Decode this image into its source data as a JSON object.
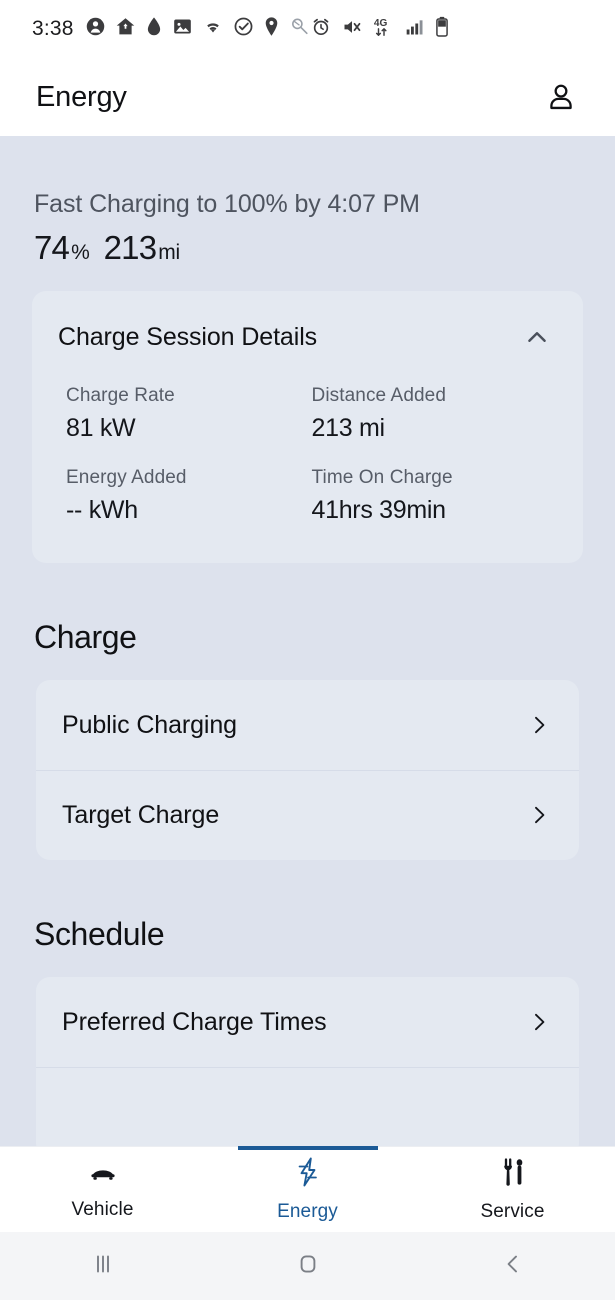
{
  "statusbar": {
    "time": "3:38",
    "left_icons": [
      {
        "name": "contact-icon",
        "glyph": "person-filled"
      },
      {
        "name": "home-icon",
        "glyph": "home-filled"
      },
      {
        "name": "water-drop-icon",
        "glyph": "droplet"
      },
      {
        "name": "gallery-icon",
        "glyph": "image"
      },
      {
        "name": "wifi-icon",
        "glyph": "wifi"
      },
      {
        "name": "check-circle-icon",
        "glyph": "check-circle"
      },
      {
        "name": "location-icon",
        "glyph": "pin"
      },
      {
        "name": "attachment-icon",
        "glyph": "magnifier-stroke"
      }
    ],
    "right_icons": [
      {
        "name": "alarm-icon",
        "glyph": "alarm"
      },
      {
        "name": "mute-icon",
        "glyph": "speaker-muted"
      },
      {
        "name": "network-4g-lte-icon",
        "glyph": "4G",
        "label": "4G"
      },
      {
        "name": "signal-bars-icon",
        "glyph": "signal"
      },
      {
        "name": "battery-icon",
        "glyph": "battery"
      }
    ]
  },
  "header": {
    "title": "Energy",
    "profile_icon": "person-icon"
  },
  "summary": {
    "status_text": "Fast Charging to 100% by 4:07 PM",
    "battery_percent": "74",
    "battery_percent_unit": "%",
    "range_value": "213",
    "range_unit": "mi"
  },
  "session_card": {
    "title": "Charge Session Details",
    "collapse_icon": "chevron-up-icon",
    "stats": [
      {
        "label": "Charge Rate",
        "value": "81 kW"
      },
      {
        "label": "Distance Added",
        "value": "213 mi"
      },
      {
        "label": "Energy Added",
        "value": "-- kWh"
      },
      {
        "label": "Time On Charge",
        "value": "41hrs 39min"
      }
    ]
  },
  "charge_section": {
    "title": "Charge",
    "rows": [
      {
        "label": "Public Charging",
        "chevron": "chevron-right-icon"
      },
      {
        "label": "Target Charge",
        "chevron": "chevron-right-icon"
      }
    ]
  },
  "schedule_section": {
    "title": "Schedule",
    "rows": [
      {
        "label": "Preferred Charge Times",
        "chevron": "chevron-right-icon"
      },
      {
        "label": "",
        "chevron": "chevron-right-icon"
      }
    ]
  },
  "tabbar": {
    "tabs": [
      {
        "label": "Vehicle",
        "icon": "car-icon",
        "active": false
      },
      {
        "label": "Energy",
        "icon": "bolt-icon",
        "active": true
      },
      {
        "label": "Service",
        "icon": "wrench-screwdriver-icon",
        "active": false
      }
    ],
    "active_color": "#1b5a96"
  },
  "navbar": {
    "buttons": [
      {
        "name": "recents-button",
        "icon": "recents-icon"
      },
      {
        "name": "home-button",
        "icon": "home-square-icon"
      },
      {
        "name": "back-button",
        "icon": "back-chevron-icon"
      }
    ]
  },
  "colors": {
    "page_background": "#dde2ed",
    "card_background": "#e4e9f1",
    "surface": "#ffffff",
    "accent": "#1b5a96",
    "text_primary": "#101114",
    "text_secondary": "#575d68"
  }
}
